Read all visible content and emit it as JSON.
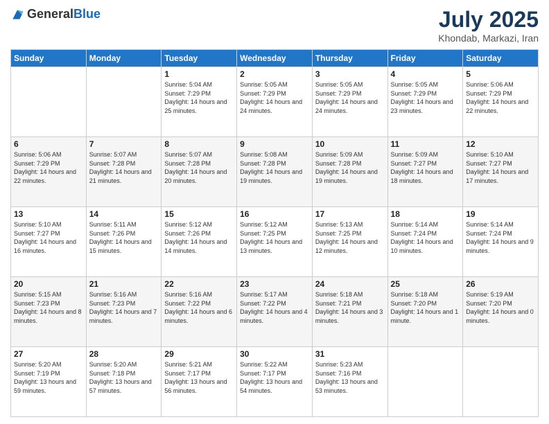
{
  "header": {
    "logo_general": "General",
    "logo_blue": "Blue",
    "title": "July 2025",
    "subtitle": "Khondab, Markazi, Iran"
  },
  "weekdays": [
    "Sunday",
    "Monday",
    "Tuesday",
    "Wednesday",
    "Thursday",
    "Friday",
    "Saturday"
  ],
  "weeks": [
    [
      null,
      null,
      {
        "day": 1,
        "sunrise": "5:04 AM",
        "sunset": "7:29 PM",
        "daylight": "14 hours and 25 minutes."
      },
      {
        "day": 2,
        "sunrise": "5:05 AM",
        "sunset": "7:29 PM",
        "daylight": "14 hours and 24 minutes."
      },
      {
        "day": 3,
        "sunrise": "5:05 AM",
        "sunset": "7:29 PM",
        "daylight": "14 hours and 24 minutes."
      },
      {
        "day": 4,
        "sunrise": "5:05 AM",
        "sunset": "7:29 PM",
        "daylight": "14 hours and 23 minutes."
      },
      {
        "day": 5,
        "sunrise": "5:06 AM",
        "sunset": "7:29 PM",
        "daylight": "14 hours and 22 minutes."
      }
    ],
    [
      {
        "day": 6,
        "sunrise": "5:06 AM",
        "sunset": "7:29 PM",
        "daylight": "14 hours and 22 minutes."
      },
      {
        "day": 7,
        "sunrise": "5:07 AM",
        "sunset": "7:28 PM",
        "daylight": "14 hours and 21 minutes."
      },
      {
        "day": 8,
        "sunrise": "5:07 AM",
        "sunset": "7:28 PM",
        "daylight": "14 hours and 20 minutes."
      },
      {
        "day": 9,
        "sunrise": "5:08 AM",
        "sunset": "7:28 PM",
        "daylight": "14 hours and 19 minutes."
      },
      {
        "day": 10,
        "sunrise": "5:09 AM",
        "sunset": "7:28 PM",
        "daylight": "14 hours and 19 minutes."
      },
      {
        "day": 11,
        "sunrise": "5:09 AM",
        "sunset": "7:27 PM",
        "daylight": "14 hours and 18 minutes."
      },
      {
        "day": 12,
        "sunrise": "5:10 AM",
        "sunset": "7:27 PM",
        "daylight": "14 hours and 17 minutes."
      }
    ],
    [
      {
        "day": 13,
        "sunrise": "5:10 AM",
        "sunset": "7:27 PM",
        "daylight": "14 hours and 16 minutes."
      },
      {
        "day": 14,
        "sunrise": "5:11 AM",
        "sunset": "7:26 PM",
        "daylight": "14 hours and 15 minutes."
      },
      {
        "day": 15,
        "sunrise": "5:12 AM",
        "sunset": "7:26 PM",
        "daylight": "14 hours and 14 minutes."
      },
      {
        "day": 16,
        "sunrise": "5:12 AM",
        "sunset": "7:25 PM",
        "daylight": "14 hours and 13 minutes."
      },
      {
        "day": 17,
        "sunrise": "5:13 AM",
        "sunset": "7:25 PM",
        "daylight": "14 hours and 12 minutes."
      },
      {
        "day": 18,
        "sunrise": "5:14 AM",
        "sunset": "7:24 PM",
        "daylight": "14 hours and 10 minutes."
      },
      {
        "day": 19,
        "sunrise": "5:14 AM",
        "sunset": "7:24 PM",
        "daylight": "14 hours and 9 minutes."
      }
    ],
    [
      {
        "day": 20,
        "sunrise": "5:15 AM",
        "sunset": "7:23 PM",
        "daylight": "14 hours and 8 minutes."
      },
      {
        "day": 21,
        "sunrise": "5:16 AM",
        "sunset": "7:23 PM",
        "daylight": "14 hours and 7 minutes."
      },
      {
        "day": 22,
        "sunrise": "5:16 AM",
        "sunset": "7:22 PM",
        "daylight": "14 hours and 6 minutes."
      },
      {
        "day": 23,
        "sunrise": "5:17 AM",
        "sunset": "7:22 PM",
        "daylight": "14 hours and 4 minutes."
      },
      {
        "day": 24,
        "sunrise": "5:18 AM",
        "sunset": "7:21 PM",
        "daylight": "14 hours and 3 minutes."
      },
      {
        "day": 25,
        "sunrise": "5:18 AM",
        "sunset": "7:20 PM",
        "daylight": "14 hours and 1 minute."
      },
      {
        "day": 26,
        "sunrise": "5:19 AM",
        "sunset": "7:20 PM",
        "daylight": "14 hours and 0 minutes."
      }
    ],
    [
      {
        "day": 27,
        "sunrise": "5:20 AM",
        "sunset": "7:19 PM",
        "daylight": "13 hours and 59 minutes."
      },
      {
        "day": 28,
        "sunrise": "5:20 AM",
        "sunset": "7:18 PM",
        "daylight": "13 hours and 57 minutes."
      },
      {
        "day": 29,
        "sunrise": "5:21 AM",
        "sunset": "7:17 PM",
        "daylight": "13 hours and 56 minutes."
      },
      {
        "day": 30,
        "sunrise": "5:22 AM",
        "sunset": "7:17 PM",
        "daylight": "13 hours and 54 minutes."
      },
      {
        "day": 31,
        "sunrise": "5:23 AM",
        "sunset": "7:16 PM",
        "daylight": "13 hours and 53 minutes."
      },
      null,
      null
    ]
  ]
}
